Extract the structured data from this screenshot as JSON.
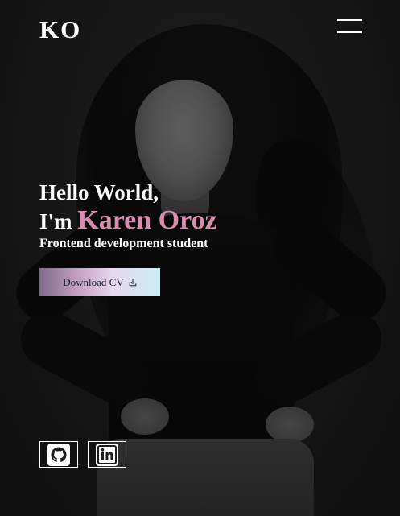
{
  "header": {
    "logo": "KO",
    "menu_icon": "hamburger-menu-icon"
  },
  "hero": {
    "greeting": "Hello World,",
    "intro_prefix": "I'm",
    "name": "Karen Oroz",
    "role": "Frontend development student",
    "download_label": "Download CV",
    "download_icon": "download-icon"
  },
  "social": [
    {
      "name": "GitHub",
      "icon": "github-icon"
    },
    {
      "name": "LinkedIn",
      "icon": "linkedin-icon"
    }
  ],
  "colors": {
    "name_accent": "#d98db0",
    "button_gradient": [
      "#7f6c8a",
      "#caa5c9",
      "#e6d7ee",
      "#cbecf5"
    ],
    "background": "#1b1b1b",
    "text": "#ffffff"
  }
}
